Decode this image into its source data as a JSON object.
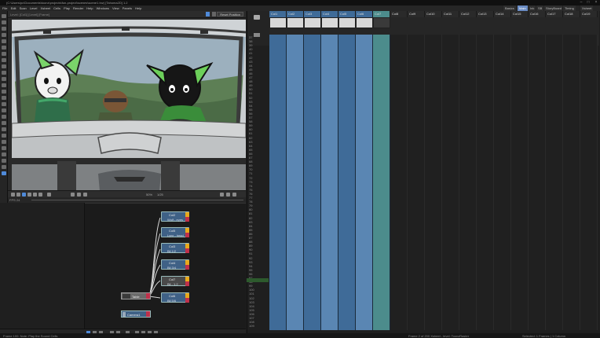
{
  "title_bar": {
    "text": "(C:\\Users\\pc\\Documents\\toonz\\projects\\fun-project\\scenes\\scene1.tnz) [Tahoma2D] 1.2"
  },
  "menu": [
    "File",
    "Edit",
    "Scan",
    "Level",
    "Xsheet",
    "Cells",
    "Play",
    "Render",
    "Help",
    "Windows",
    "View",
    "Panels",
    "Help"
  ],
  "rooms": [
    "Basics",
    "Main",
    "Ink",
    "SB",
    "StoryBoard",
    "Timing",
    "Xsheet"
  ],
  "viewer": {
    "label": "Level: [Col1] [Level] [Frame]",
    "reset_label": "Reset Position",
    "zoom_label": "50%",
    "frame_label": "1/25"
  },
  "frame_field": "FPS 24",
  "nodes": [
    {
      "title": "Col2",
      "sub": "Wolf - eyes"
    },
    {
      "title": "Col5",
      "sub": "Lynx - head"
    },
    {
      "title": "Col3",
      "sub": "Bil 1/2"
    },
    {
      "title": "Col4",
      "sub": "Bil 3/4"
    },
    {
      "title": "Col7",
      "sub": "Bil - 1,2"
    },
    {
      "title": "Col6",
      "sub": "Bil 5/6"
    }
  ],
  "table_node": "Table",
  "camera_node": "Camera1",
  "xsheet": {
    "columns": [
      "Col1",
      "Col2",
      "Col3",
      "Col4",
      "Col5",
      "Col6",
      "Col7",
      "Col8",
      "Col9",
      "Col10",
      "Col11",
      "Col12",
      "Col13",
      "Col14",
      "Col15",
      "Col16",
      "Col17",
      "Col18",
      "Col19"
    ],
    "row_start": 37,
    "row_count": 73,
    "current_row": 100
  },
  "status": {
    "left": "Frame 100: Note: Play the Sound Cells",
    "right_a": "Frame 2 of 200 Xsheet - level: ToonzRaster",
    "right_b": "Selected: 1 Frames | 1 Column"
  },
  "colors": {
    "col_blue": "#3f6b98",
    "col_blue_light": "#5a86b3",
    "col_sound": "#4c8c8c",
    "accent": "#6a8cc4"
  }
}
